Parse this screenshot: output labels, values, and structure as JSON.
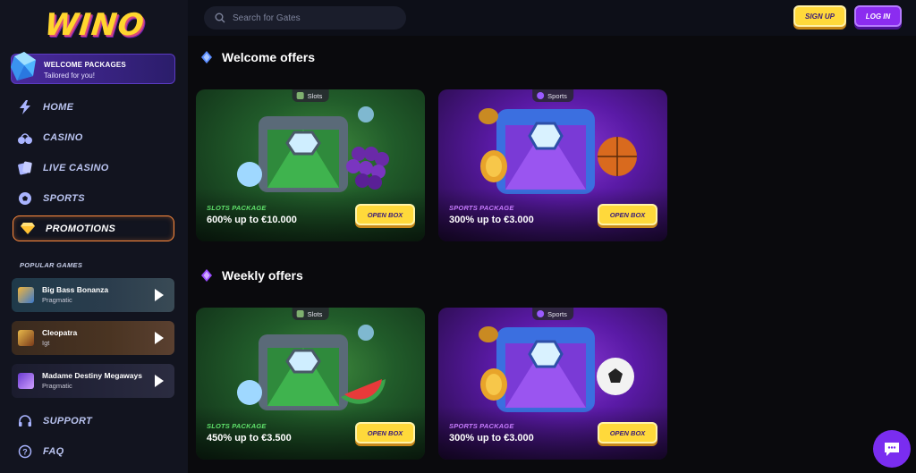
{
  "brand": {
    "logo_text": "WINO"
  },
  "sidebar": {
    "welcome": {
      "title": "WELCOME PACKAGES",
      "subtitle": "Tailored for you!"
    },
    "nav": [
      {
        "label": "HOME",
        "icon": "lightning-icon"
      },
      {
        "label": "CASINO",
        "icon": "cherries-icon"
      },
      {
        "label": "LIVE CASINO",
        "icon": "cards-icon"
      },
      {
        "label": "SPORTS",
        "icon": "soccer-ball-icon"
      },
      {
        "label": "PROMOTIONS",
        "icon": "diamond-icon"
      }
    ],
    "popular_label": "POPULAR GAMES",
    "games": [
      {
        "title": "Big Bass Bonanza",
        "provider": "Pragmatic"
      },
      {
        "title": "Cleopatra",
        "provider": "Igt"
      },
      {
        "title": "Madame Destiny Megaways",
        "provider": "Pragmatic"
      }
    ],
    "footer_nav": [
      {
        "label": "SUPPORT",
        "icon": "headset-icon"
      },
      {
        "label": "FAQ",
        "icon": "question-icon"
      }
    ]
  },
  "header": {
    "search_placeholder": "Search for Gates",
    "signup_label": "SIGN UP",
    "login_label": "LOG IN"
  },
  "sections": [
    {
      "title": "Welcome offers",
      "cards": [
        {
          "tag": "Slots",
          "package": "SLOTS PACKAGE",
          "offer": "600% up to €10.000",
          "button": "OPEN BOX"
        },
        {
          "tag": "Sports",
          "package": "SPORTS PACKAGE",
          "offer": "300% up to €3.000",
          "button": "OPEN BOX"
        }
      ]
    },
    {
      "title": "Weekly offers",
      "cards": [
        {
          "tag": "Slots",
          "package": "SLOTS PACKAGE",
          "offer": "450% up to €3.500",
          "button": "OPEN BOX"
        },
        {
          "tag": "Sports",
          "package": "SPORTS PACKAGE",
          "offer": "300% up to €3.000",
          "button": "OPEN BOX"
        }
      ]
    }
  ],
  "colors": {
    "background": "#0a0a0d",
    "sidebar": "#12141f",
    "accent_yellow": "#ffd93b",
    "accent_purple": "#8b2cf0",
    "promo_border": "#ff8a3d",
    "slots_green": "#5fe06a",
    "sports_purple": "#c77bff"
  }
}
